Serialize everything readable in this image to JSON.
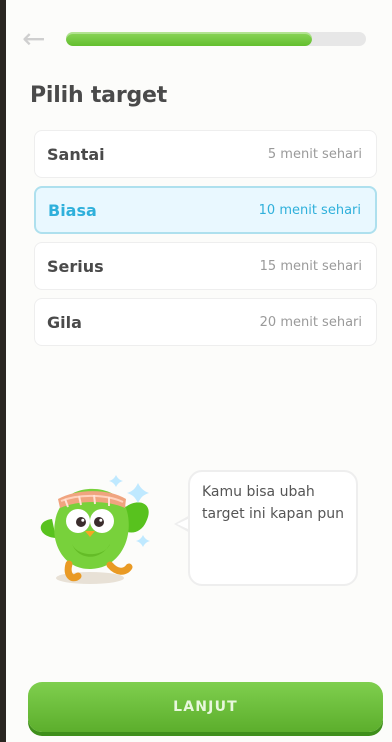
{
  "header": {
    "back_icon": "arrow-left-icon",
    "progress_fraction": 0.82
  },
  "page": {
    "title": "Pilih target"
  },
  "goals": [
    {
      "name": "Santai",
      "time": "5 menit sehari",
      "selected": false
    },
    {
      "name": "Biasa",
      "time": "10 menit sehari",
      "selected": true
    },
    {
      "name": "Serius",
      "time": "15 menit sehari",
      "selected": false
    },
    {
      "name": "Gila",
      "time": "20 menit sehari",
      "selected": false
    }
  ],
  "mascot": {
    "icon": "owl-mascot",
    "message": "Kamu bisa ubah target ini kapan pun"
  },
  "footer": {
    "continue_label": "LANJUT"
  },
  "colors": {
    "brand_green": "#58cc02",
    "selected_blue": "#2fb0db",
    "selected_bg": "#e9f8ff"
  }
}
